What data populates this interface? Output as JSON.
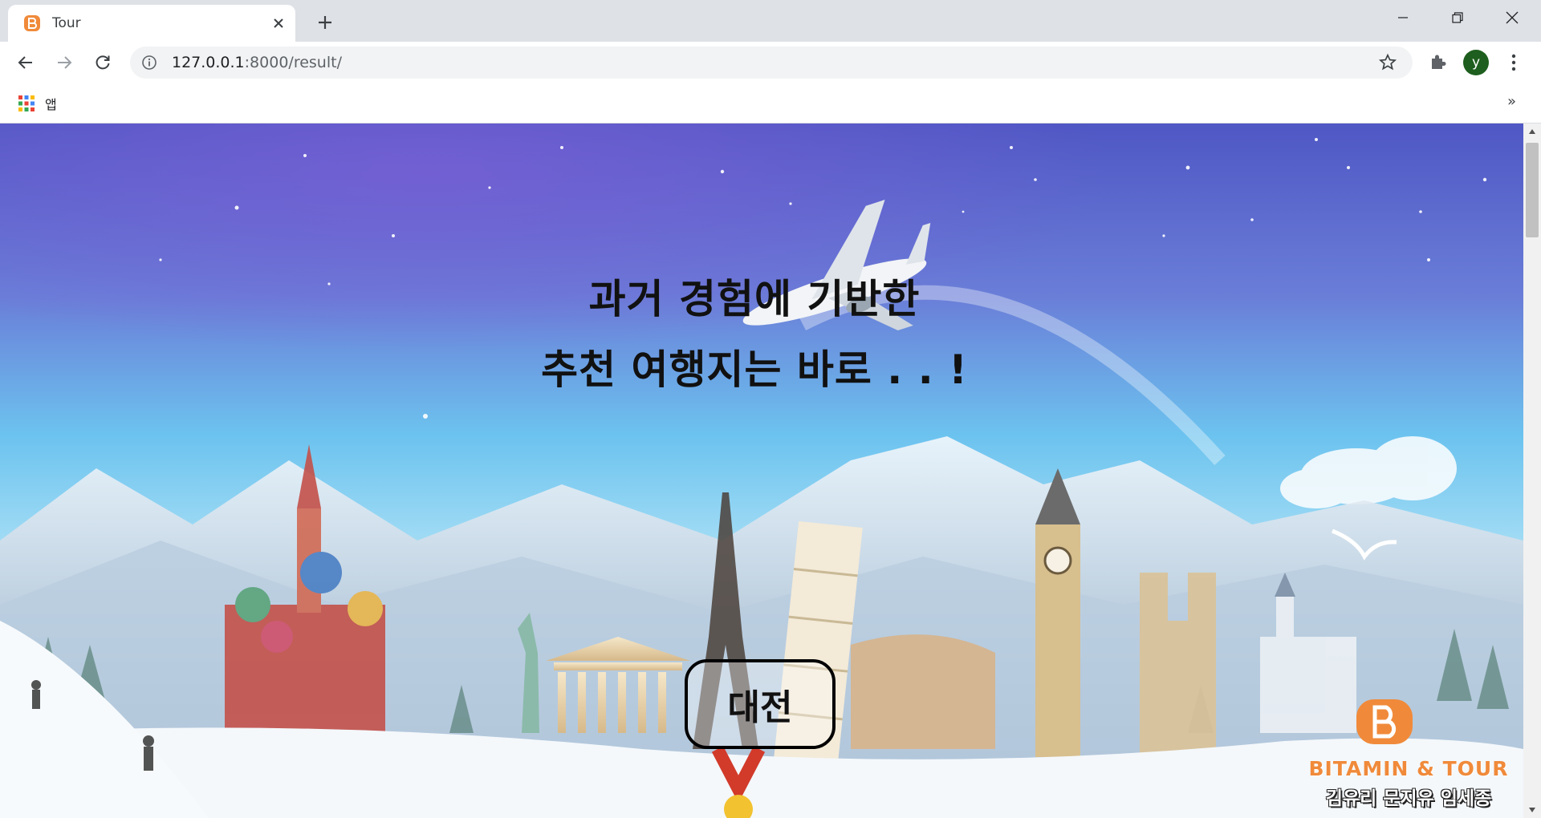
{
  "browser": {
    "tab_title": "Tour",
    "url_host": "127.0.0.1",
    "url_path": ":8000/result/",
    "bookmarks_apps_label": "앱",
    "bookmarks_more": "»",
    "profile_initial": "y"
  },
  "page": {
    "headline_line1": "과거 경험에 기반한",
    "headline_line2": "추천 여행지는 바로 . . !",
    "result_button_label": "대전",
    "brand_name": "BITAMIN & TOUR",
    "brand_credits": "김유리 문지유 임세종"
  },
  "colors": {
    "brand_orange": "#f08a3a",
    "avatar_green": "#1e5e1e",
    "sky_top": "#5a5fc8",
    "sky_mid": "#6fc7f0",
    "snow": "#eef6fb"
  }
}
